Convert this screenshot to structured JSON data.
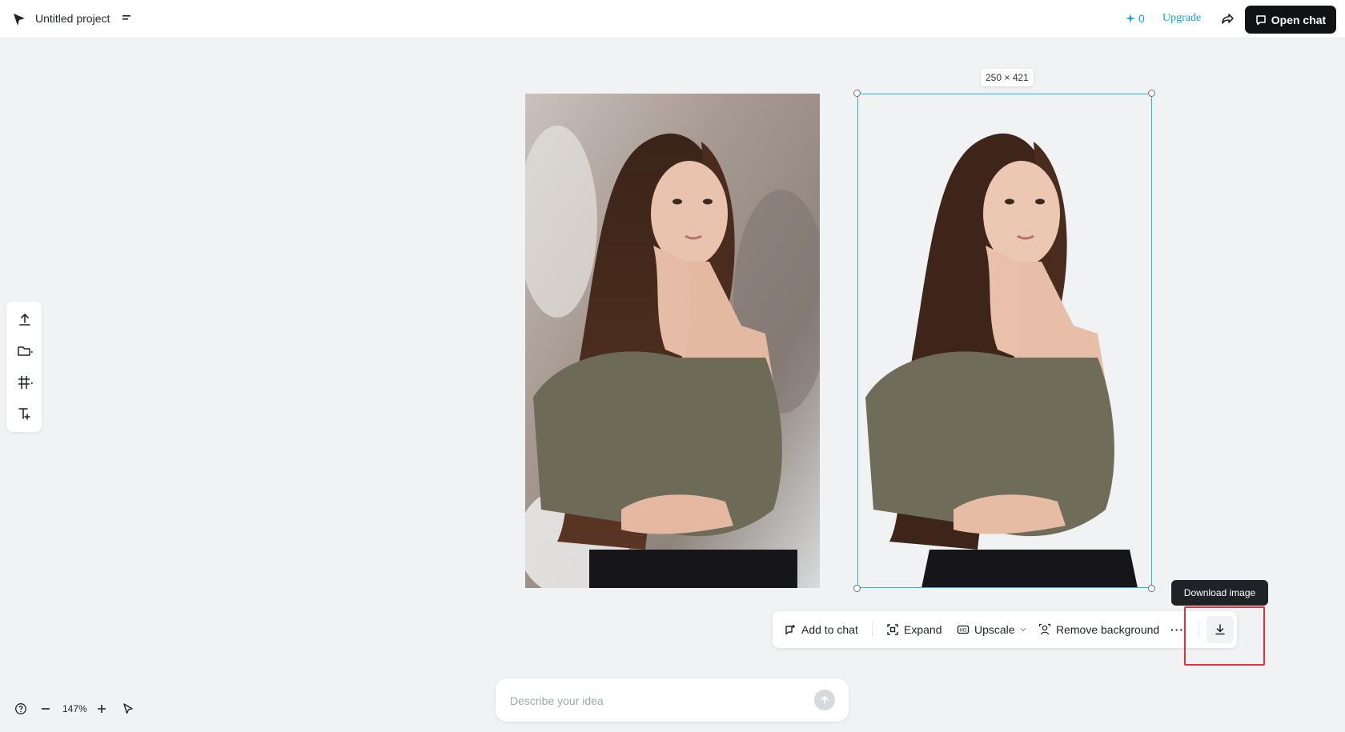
{
  "topbar": {
    "project_title": "Untitled project",
    "credits": "0",
    "upgrade_label": "Upgrade",
    "open_chat_label": "Open chat"
  },
  "canvas": {
    "selection_size_label": "250 × 421"
  },
  "action_bar": {
    "add_to_chat": "Add to chat",
    "expand": "Expand",
    "upscale": "Upscale",
    "remove_background": "Remove background",
    "more": "···"
  },
  "tooltip": {
    "download_image": "Download image"
  },
  "prompt": {
    "placeholder": "Describe your idea",
    "value": ""
  },
  "zoom": {
    "level": "147%"
  },
  "colors": {
    "accent": "#15a0d8",
    "selection": "#22b5d6",
    "highlight": "#e0323c",
    "dark_button": "#111214"
  },
  "icons": {
    "logo": "logo-icon",
    "menu": "menu-icon",
    "share": "share-icon",
    "chat": "chat-icon",
    "upload": "upload-icon",
    "folder": "folder-icon",
    "frame": "frame-icon",
    "text": "text-tool-icon",
    "download": "download-icon",
    "send": "send-icon",
    "help": "help-icon",
    "zoom_out": "minus-icon",
    "zoom_in": "plus-icon",
    "pointer": "pointer-icon"
  }
}
